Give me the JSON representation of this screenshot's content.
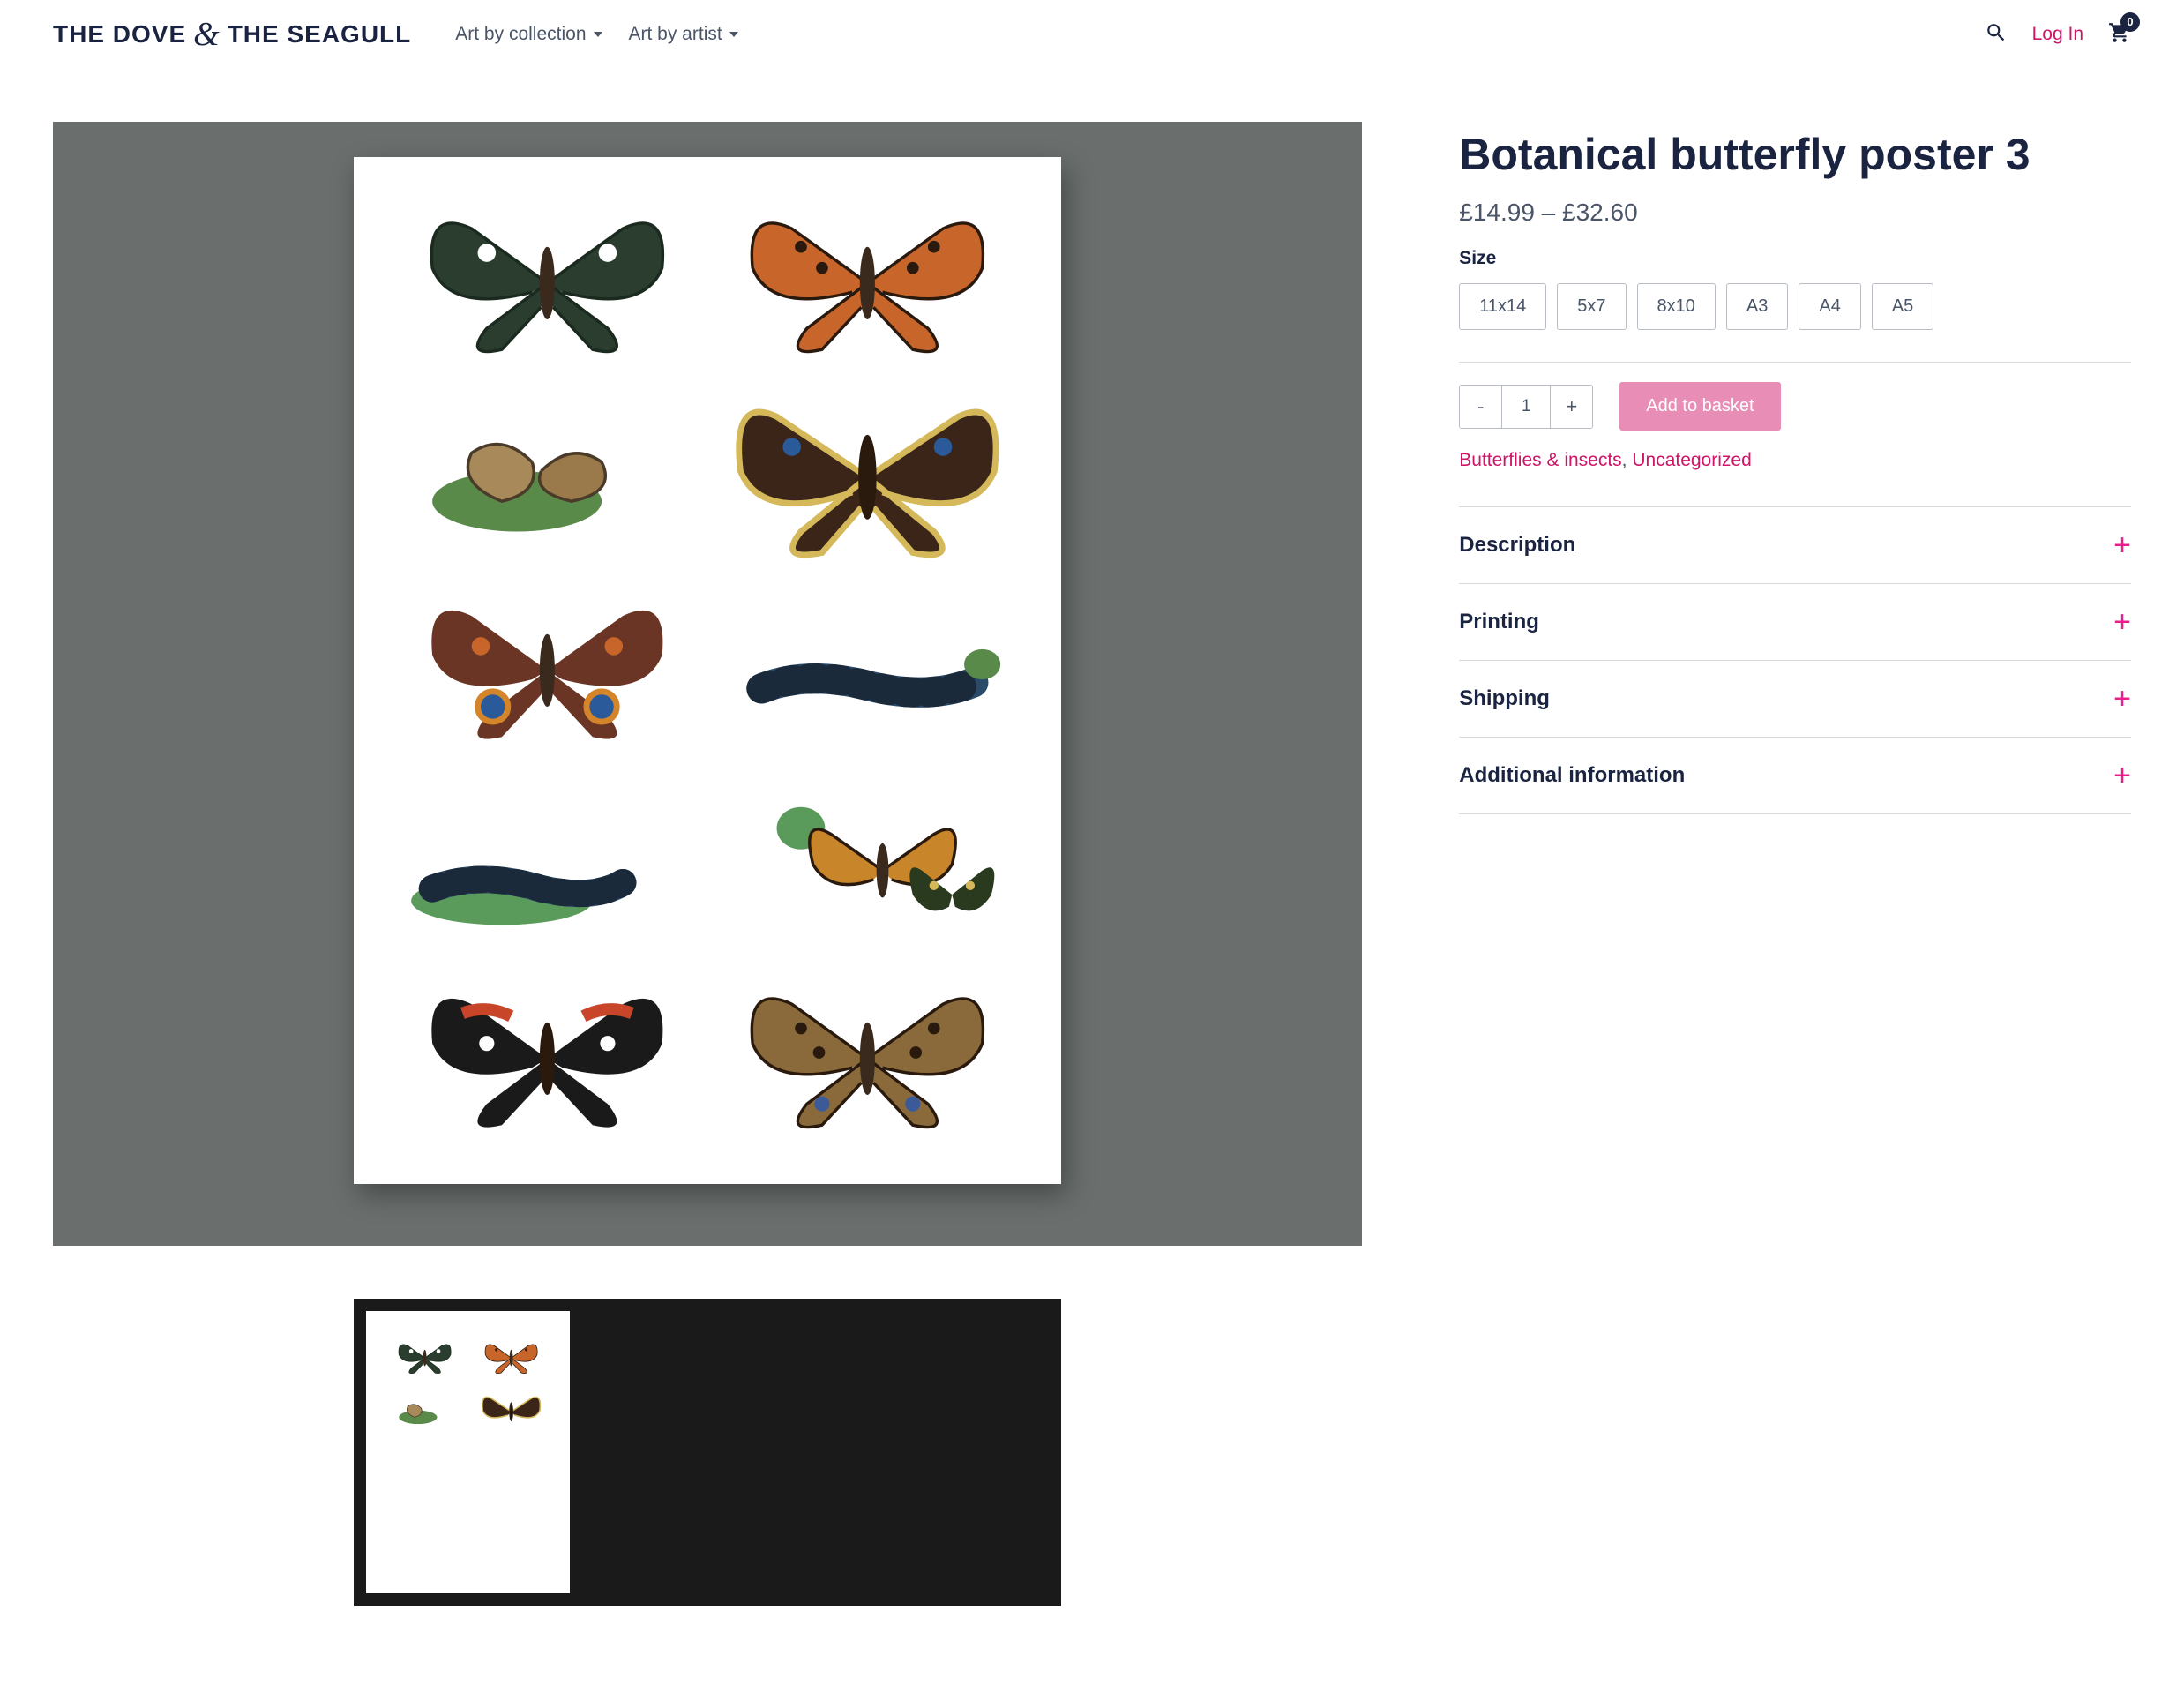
{
  "header": {
    "logo_left": "THE DOVE",
    "logo_amp": "&",
    "logo_right": "THE SEAGULL",
    "nav": [
      {
        "label": "Art by collection"
      },
      {
        "label": "Art by artist"
      }
    ],
    "login": "Log In",
    "cart_count": "0"
  },
  "product": {
    "title": "Botanical butterfly poster 3",
    "price": "£14.99 – £32.60",
    "size_label": "Size",
    "sizes": [
      "11x14",
      "5x7",
      "8x10",
      "A3",
      "A4",
      "A5"
    ],
    "qty": "1",
    "add_to_cart": "Add to basket",
    "categories": [
      {
        "label": "Butterflies & insects"
      },
      {
        "label": "Uncategorized"
      }
    ]
  },
  "accordion": [
    {
      "title": "Description"
    },
    {
      "title": "Printing"
    },
    {
      "title": "Shipping"
    },
    {
      "title": "Additional information"
    }
  ]
}
